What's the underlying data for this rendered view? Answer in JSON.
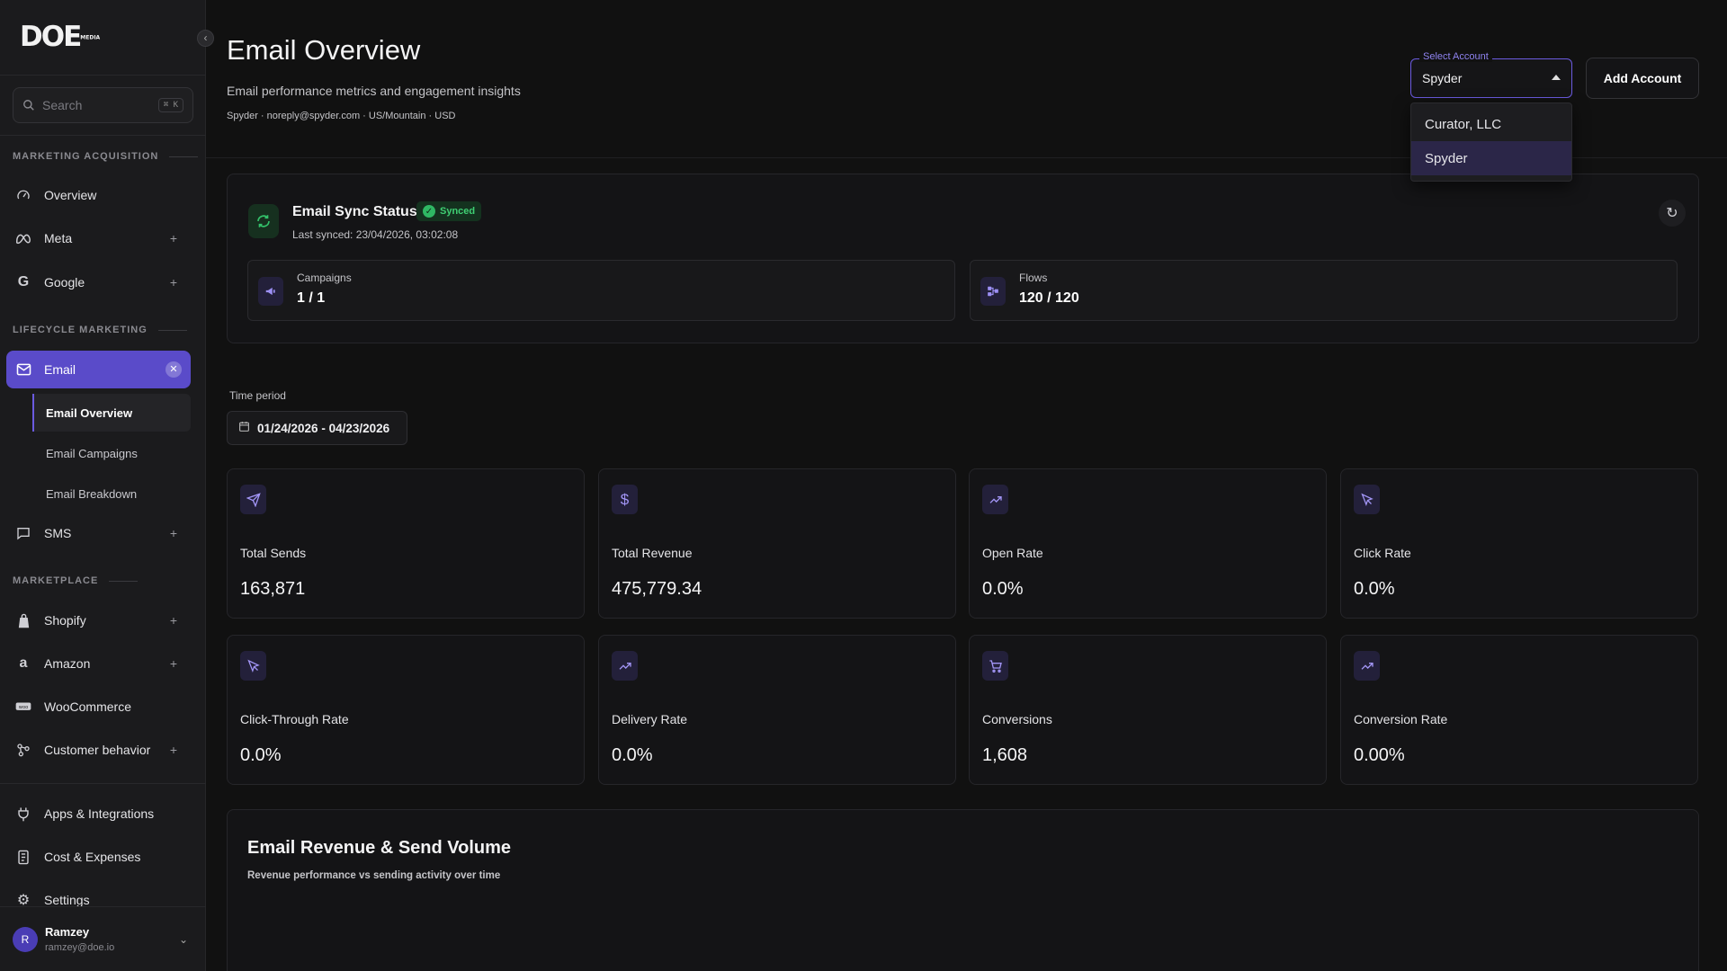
{
  "brand": {
    "logo_text": "DOE",
    "logo_small": "MEDIA"
  },
  "sidebar": {
    "collapse_glyph": "‹",
    "search": {
      "placeholder": "Search",
      "shortcut": "⌘ K"
    },
    "sections": {
      "marketing_acquisition": "MARKETING ACQUISITION",
      "lifecycle_marketing": "LIFECYCLE MARKETING",
      "marketplace": "MARKETPLACE"
    },
    "items": {
      "overview": "Overview",
      "meta": "Meta",
      "google": "Google",
      "email": "Email",
      "email_overview": "Email Overview",
      "email_campaigns": "Email Campaigns",
      "email_breakdown": "Email Breakdown",
      "sms": "SMS",
      "shopify": "Shopify",
      "amazon": "Amazon",
      "woocommerce": "WooCommerce",
      "customer_behavior": "Customer behavior",
      "apps_integrations": "Apps & Integrations",
      "cost_expenses": "Cost & Expenses",
      "settings": "Settings"
    },
    "user": {
      "initial": "R",
      "name": "Ramzey",
      "email": "ramzey@doe.io"
    }
  },
  "header": {
    "title": "Email Overview",
    "subtitle": "Email performance metrics and engagement insights",
    "meta": "Spyder · noreply@spyder.com · US/Mountain · USD",
    "account_select": {
      "legend": "Select Account",
      "value": "Spyder",
      "options": [
        "Curator, LLC",
        "Spyder"
      ]
    },
    "add_account_label": "Add Account"
  },
  "sync": {
    "title": "Email Sync Status",
    "badge": "Synced",
    "last_synced": "Last synced: 23/04/2026, 03:02:08",
    "campaigns": {
      "label": "Campaigns",
      "value": "1 / 1"
    },
    "flows": {
      "label": "Flows",
      "value": "120 / 120"
    }
  },
  "time_period": {
    "label": "Time period",
    "range": "01/24/2026 - 04/23/2026"
  },
  "metrics": [
    {
      "icon": "send-icon",
      "label": "Total Sends",
      "value": "163,871"
    },
    {
      "icon": "dollar-icon",
      "label": "Total Revenue",
      "value": "475,779.34"
    },
    {
      "icon": "trending-up-icon",
      "label": "Open Rate",
      "value": "0.0%"
    },
    {
      "icon": "cursor-icon",
      "label": "Click Rate",
      "value": "0.0%"
    },
    {
      "icon": "cursor-icon",
      "label": "Click-Through Rate",
      "value": "0.0%"
    },
    {
      "icon": "trending-up-icon",
      "label": "Delivery Rate",
      "value": "0.0%"
    },
    {
      "icon": "cart-icon",
      "label": "Conversions",
      "value": "1,608"
    },
    {
      "icon": "trending-up-icon",
      "label": "Conversion Rate",
      "value": "0.00%"
    }
  ],
  "chart_section": {
    "title": "Email Revenue & Send Volume",
    "subtitle": "Revenue performance vs sending activity over time"
  },
  "colors": {
    "accent": "#5a4bc9",
    "accent_light": "#8f83f0",
    "success": "#3fcf73",
    "background": "#111111",
    "sidebar": "#1b1b1d"
  }
}
